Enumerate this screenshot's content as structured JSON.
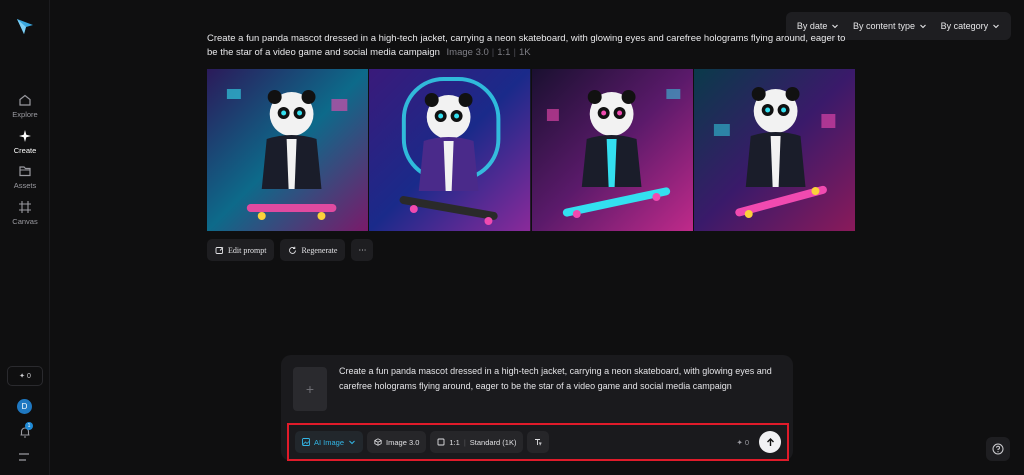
{
  "sidebar": {
    "logo_icon": "star-logo",
    "items": [
      {
        "label": "Explore",
        "icon": "home-icon"
      },
      {
        "label": "Create",
        "icon": "sparkle-icon"
      },
      {
        "label": "Assets",
        "icon": "folder-icon"
      },
      {
        "label": "Canvas",
        "icon": "canvas-icon"
      }
    ],
    "credits": "✦ 0",
    "avatar_initial": "D",
    "notification_count": "1"
  },
  "filters": {
    "by_date": "By date",
    "by_content_type": "By content type",
    "by_category": "By category"
  },
  "result": {
    "prompt": "Create a fun panda mascot dressed in a high-tech jacket, carrying a neon skateboard, with glowing eyes and carefree holograms flying around, eager to be the star of a video game and social media campaign",
    "model": "Image 3.0",
    "ratio": "1:1",
    "resolution": "1K",
    "images": [
      "panda-1",
      "panda-2",
      "panda-3",
      "panda-4"
    ]
  },
  "actions": {
    "edit_prompt": "Edit prompt",
    "regenerate": "Regenerate",
    "more": "···"
  },
  "composer": {
    "add_icon": "+",
    "text": "Create a fun panda mascot dressed in a high-tech jacket, carrying a neon skateboard, with glowing eyes and carefree holograms flying around, eager to be the star of a video game and social media campaign",
    "mode": "AI Image",
    "model": "Image 3.0",
    "ratio": "1:1",
    "quality": "Standard (1K)",
    "credit_cost": "✦ 0"
  },
  "colors": {
    "accent": "#33b6e6",
    "highlight_border": "#e01b2a",
    "background": "#0f0f10"
  }
}
